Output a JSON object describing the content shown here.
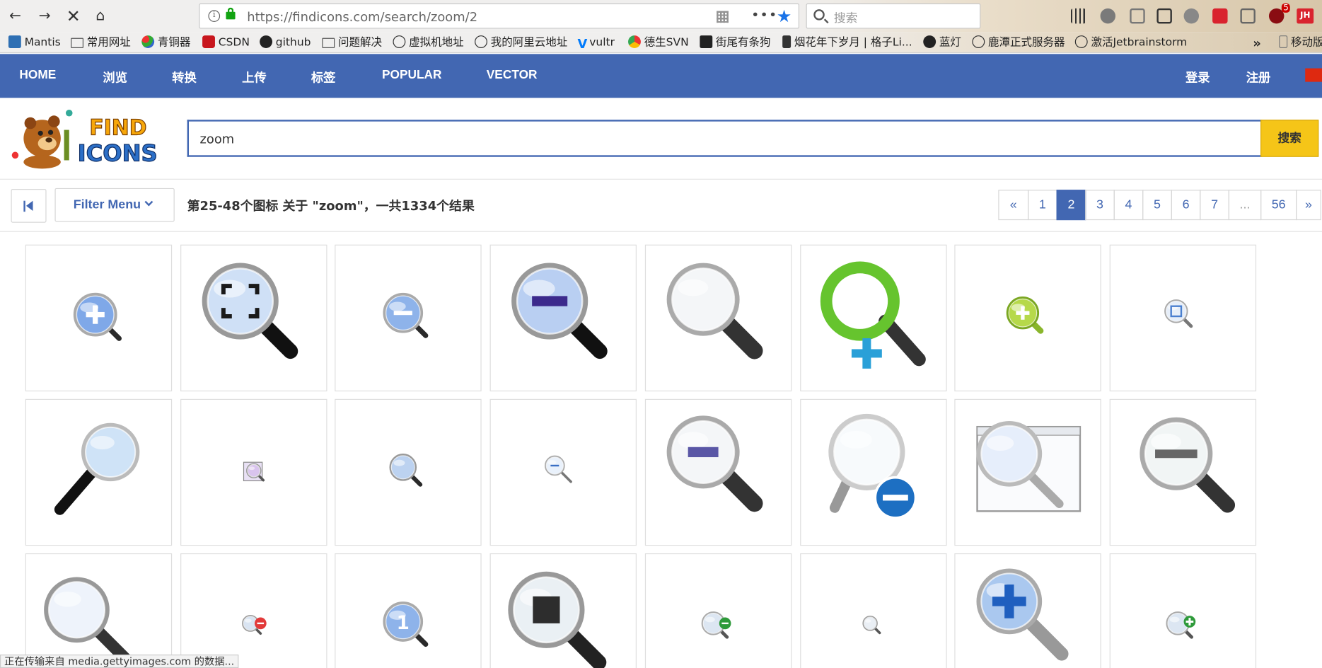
{
  "browser": {
    "url": "https://findicons.com/search/zoom/2",
    "search_placeholder": "搜索",
    "badge_count": "5",
    "profile_initials": "JH",
    "overflow_label": "移动版",
    "status_text": "正在传输来自 media.gettyimages.com 的数据..."
  },
  "bookmarks": [
    "Mantis",
    "常用网址",
    "青铜器",
    "CSDN",
    "github",
    "问题解决",
    "虚拟机地址",
    "我的阿里云地址",
    "vultr",
    "德生SVN",
    "街尾有条狗",
    "烟花年下岁月 | 格子Li...",
    "蓝灯",
    "鹿潭正式服务器",
    "激活Jetbrainstorm"
  ],
  "nav": {
    "items": [
      "HOME",
      "浏览",
      "转换",
      "上传",
      "标签",
      "POPULAR",
      "VECTOR"
    ],
    "login": "登录",
    "register": "注册"
  },
  "logo": {
    "line1": "FIND",
    "line2": "ICONS"
  },
  "search": {
    "value": "zoom",
    "button": "搜索"
  },
  "toolbar": {
    "filter_label": "Filter Menu",
    "results_text": "第25-48个图标 关于 \"zoom\"，一共1334个结果"
  },
  "pagination": {
    "prev": "«",
    "pages": [
      "1",
      "2",
      "3",
      "4",
      "5",
      "6",
      "7"
    ],
    "current": "2",
    "ellipsis": "...",
    "last": "56",
    "next": "»"
  },
  "icons": [
    {
      "name": "zoom-in-icon",
      "kind": "zoom-in"
    },
    {
      "name": "zoom-fit-icon",
      "kind": "zoom-fit"
    },
    {
      "name": "zoom-out-icon",
      "kind": "zoom-out"
    },
    {
      "name": "zoom-out-icon",
      "kind": "zoom-out-large"
    },
    {
      "name": "magnifier-icon",
      "kind": "magnifier"
    },
    {
      "name": "green-zoom-in-icon",
      "kind": "green-female"
    },
    {
      "name": "green-zoom-in-icon",
      "kind": "green-plus"
    },
    {
      "name": "zoom-fit-icon",
      "kind": "zoom-fit-small"
    },
    {
      "name": "magnifier-icon",
      "kind": "magnifier-blue"
    },
    {
      "name": "zoom-page-icon",
      "kind": "tiny-page"
    },
    {
      "name": "magnifier-icon",
      "kind": "small-magnifier"
    },
    {
      "name": "zoom-out-icon",
      "kind": "small-zoom-out"
    },
    {
      "name": "zoom-out-icon",
      "kind": "zoom-out-bar"
    },
    {
      "name": "zoom-out-icon",
      "kind": "zoom-out-blue-badge"
    },
    {
      "name": "zoom-window-icon",
      "kind": "window"
    },
    {
      "name": "zoom-out-icon",
      "kind": "zoom-out-bar-2"
    },
    {
      "name": "magnifier-icon",
      "kind": "magnifier-cut"
    },
    {
      "name": "zoom-out-icon",
      "kind": "tiny-red-minus"
    },
    {
      "name": "zoom-actual-size-icon",
      "kind": "zoom-one",
      "label": "1"
    },
    {
      "name": "zoom-stop-icon",
      "kind": "zoom-square"
    },
    {
      "name": "zoom-out-icon",
      "kind": "green-minus-small"
    },
    {
      "name": "magnifier-icon",
      "kind": "tiny-magnifier"
    },
    {
      "name": "zoom-in-icon",
      "kind": "big-plus"
    },
    {
      "name": "zoom-in-icon",
      "kind": "green-plus-small"
    }
  ],
  "colors": {
    "nav": "#4267b2",
    "search_button": "#f5c518",
    "active_page": "#4267b2"
  }
}
